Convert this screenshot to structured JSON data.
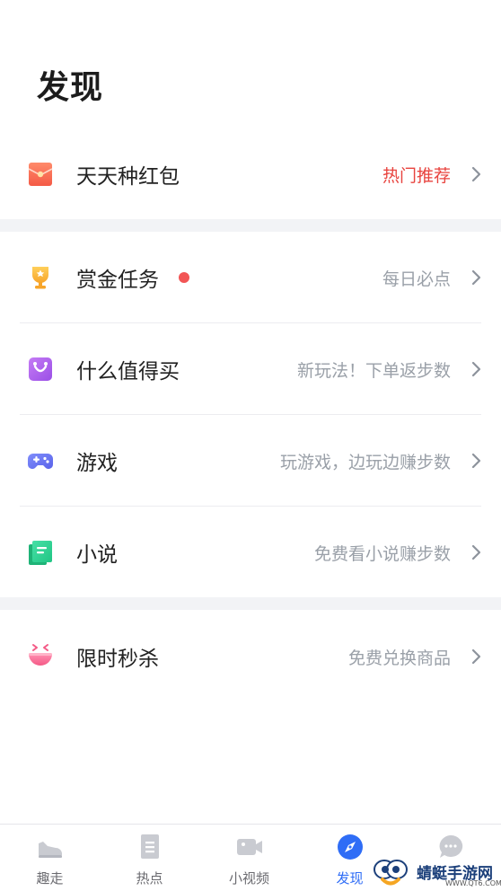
{
  "header": {
    "title": "发现"
  },
  "items": [
    {
      "label": "天天种红包",
      "subtext": "热门推荐",
      "icon": "red-envelope-icon",
      "hot": true
    },
    {
      "label": "赏金任务",
      "subtext": "每日必点",
      "icon": "trophy-icon",
      "badge": "red-dot"
    },
    {
      "label": "什么值得买",
      "subtext": "新玩法！下单返步数",
      "icon": "shopping-bag-icon"
    },
    {
      "label": "游戏",
      "subtext": "玩游戏，边玩边赚步数",
      "icon": "gamepad-icon"
    },
    {
      "label": "小说",
      "subtext": "免费看小说赚步数",
      "icon": "book-icon"
    },
    {
      "label": "限时秒杀",
      "subtext": "免费兑换商品",
      "icon": "flash-sale-bowl-icon"
    }
  ],
  "tabbar": {
    "tabs": [
      {
        "label": "趣走",
        "icon": "sneaker-icon",
        "active": false
      },
      {
        "label": "热点",
        "icon": "document-icon",
        "active": false
      },
      {
        "label": "小视频",
        "icon": "video-camera-icon",
        "active": false
      },
      {
        "label": "发现",
        "icon": "compass-icon",
        "active": true
      },
      {
        "label": "",
        "icon": "chat-bubble-icon",
        "active": false
      }
    ]
  },
  "watermark": {
    "text": "蜻蜓手游网",
    "sub": "WWW.QT6.COM"
  },
  "colors": {
    "hot": "#e8433e",
    "active_tab": "#2f6df6",
    "subtext": "#9aa0a8",
    "section_gap": "#f2f3f6",
    "badge_dot": "#f25555"
  }
}
